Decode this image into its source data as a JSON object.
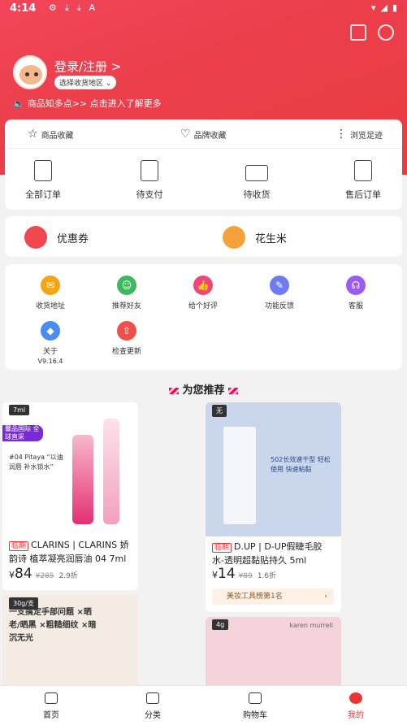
{
  "status": {
    "time": "4:14",
    "left_icons": [
      "⚙",
      "⤓",
      "⤓",
      "A"
    ],
    "right_icons": [
      "▾",
      "◢",
      "▮"
    ]
  },
  "header": {
    "login_label": "登录/注册 >",
    "region_label": "选择收货地区 ⌄",
    "notice": "商品知多点>> 点击进入了解更多"
  },
  "favorites": [
    {
      "label": "商品收藏",
      "icon": "☆"
    },
    {
      "label": "品牌收藏",
      "icon": "♡"
    },
    {
      "label": "浏览足迹",
      "icon": "⋮"
    }
  ],
  "orders": [
    {
      "label": "全部订单"
    },
    {
      "label": "待支付"
    },
    {
      "label": "待收货"
    },
    {
      "label": "售后订单"
    }
  ],
  "coupons": [
    {
      "label": "优惠券",
      "color": "#f0464e"
    },
    {
      "label": "花生米",
      "color": "#f5a13c"
    }
  ],
  "tools": [
    {
      "label": "收货地址",
      "color": "#f2a516",
      "icon": "✉"
    },
    {
      "label": "推荐好友",
      "color": "#3fb85d",
      "icon": "☺"
    },
    {
      "label": "给个好评",
      "color": "#f0457a",
      "icon": "👍"
    },
    {
      "label": "功能反馈",
      "color": "#6f7cf0",
      "icon": "✎"
    },
    {
      "label": "客服",
      "color": "#9b5cf0",
      "icon": "☊"
    },
    {
      "label": "关于",
      "color": "#4a8df0",
      "icon": "◆"
    },
    {
      "label": "检查更新",
      "color": "#f0504a",
      "icon": "⇧"
    }
  ],
  "version": "V9.16.4",
  "recommend_title": "为您推荐",
  "products": [
    {
      "tag": "7ml",
      "badge": "临期",
      "name": "CLARINS | CLARINS 娇韵诗 植萃凝亮润唇油 04 7ml",
      "price": "84",
      "orig": "¥285",
      "disc": "2.9折",
      "img_text": "#04 Pitaya “以油润唇 补水锁水”",
      "img_bg": "#ffffff",
      "promo": "馨品国际 全球直采"
    },
    {
      "tag": "无",
      "badge": "临期",
      "name": "D.UP | D-UP假睫毛胶水-透明超黏贴持久 5ml",
      "price": "14",
      "orig": "¥89",
      "disc": "1.6折",
      "rank": "美妆工具榜第1名",
      "img_text": "502长效速干型 轻松使用 快速粘黏",
      "img_bg": "#c9d6ec"
    },
    {
      "tag": "30g/支",
      "img_text": "一支搞定手部问题 ×晒老/晒黑 ×粗糙细纹 ×暗沉无光"
    },
    {
      "tag": "4g",
      "img_text": "karen murrell"
    }
  ],
  "tabs": [
    {
      "label": "首页"
    },
    {
      "label": "分类"
    },
    {
      "label": "购物车"
    },
    {
      "label": "我的"
    }
  ],
  "colors": {
    "accent": "#ea3b3e",
    "text": "#222222"
  }
}
